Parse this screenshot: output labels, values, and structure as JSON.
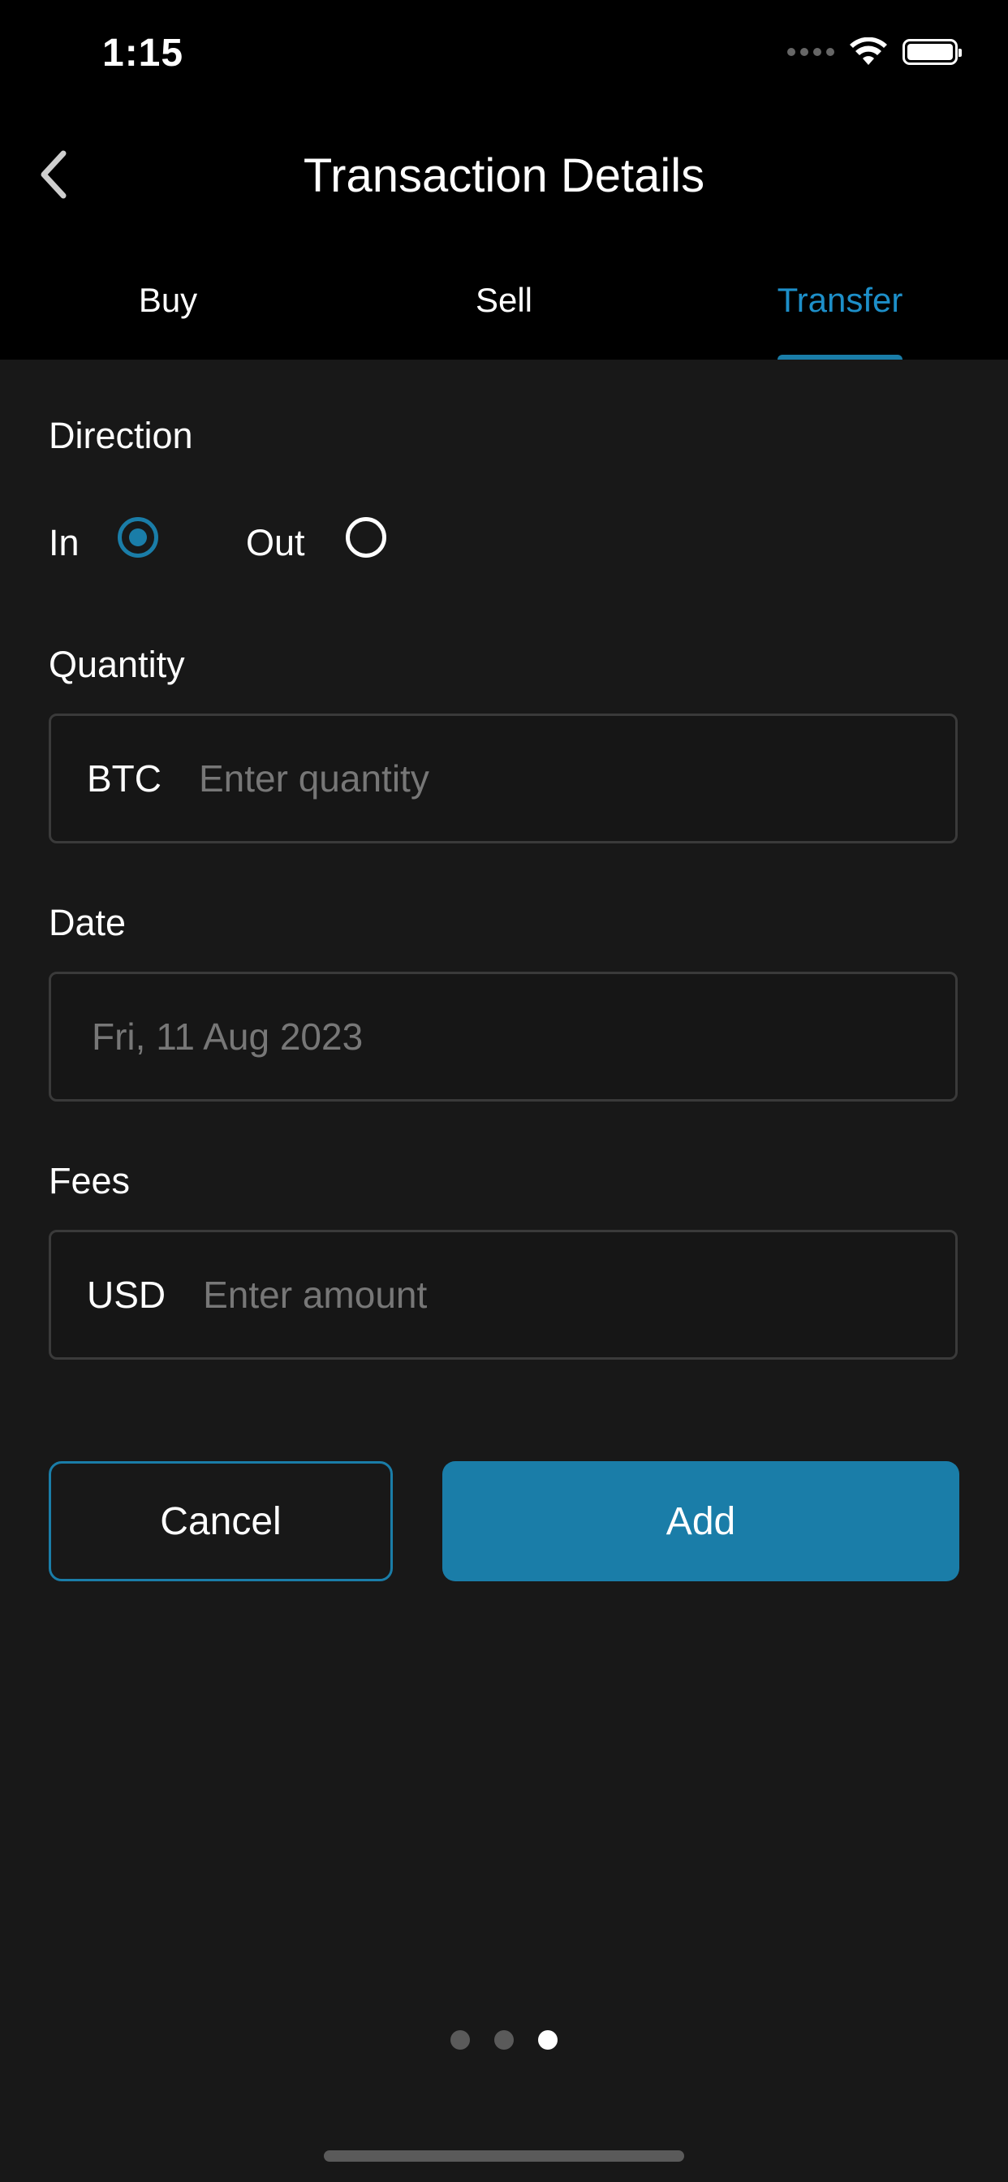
{
  "status_bar": {
    "time": "1:15",
    "icons": [
      "signal-dots-icon",
      "wifi-icon",
      "battery-icon"
    ]
  },
  "header": {
    "back_icon": "chevron-left-icon",
    "title": "Transaction Details"
  },
  "tabs": [
    {
      "label": "Buy",
      "active": false
    },
    {
      "label": "Sell",
      "active": false
    },
    {
      "label": "Transfer",
      "active": true
    }
  ],
  "direction": {
    "label": "Direction",
    "options": [
      {
        "label": "In",
        "selected": true
      },
      {
        "label": "Out",
        "selected": false
      }
    ]
  },
  "quantity": {
    "label": "Quantity",
    "currency": "BTC",
    "placeholder": "Enter quantity"
  },
  "date": {
    "label": "Date",
    "value": "Fri, 11 Aug 2023"
  },
  "fees": {
    "label": "Fees",
    "currency": "USD",
    "placeholder": "Enter amount"
  },
  "actions": {
    "cancel_label": "Cancel",
    "add_label": "Add"
  },
  "pager": {
    "current_page": 3,
    "total_pages": 3
  },
  "colors": {
    "accent": "#1a7da8",
    "active_tab_text": "#1d8fc9",
    "background": "#181818",
    "header_background": "#000000"
  }
}
